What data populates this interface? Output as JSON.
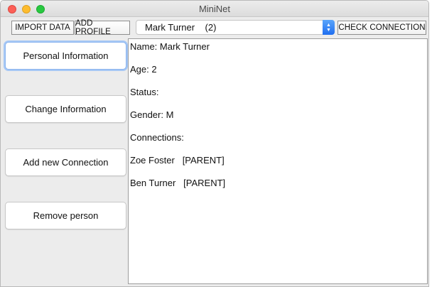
{
  "window": {
    "title": "MiniNet"
  },
  "toolbar": {
    "import_label": "IMPORT DATA",
    "add_profile_label": "ADD PROFILE",
    "person_select_value": "Mark Turner    (2)",
    "check_connection_label": "CHECK CONNECTION"
  },
  "sidebar": {
    "items": [
      {
        "label": "Personal Information"
      },
      {
        "label": "Change Information"
      },
      {
        "label": "Add new Connection"
      },
      {
        "label": "Remove person"
      }
    ]
  },
  "details": {
    "name": "Name: Mark Turner",
    "age": "Age: 2",
    "status": "Status:",
    "gender": "Gender: M",
    "connections_heading": "Connections:",
    "connections": [
      {
        "text": "Zoe Foster   [PARENT]"
      },
      {
        "text": "Ben Turner   [PARENT]"
      }
    ]
  },
  "colors": {
    "close": "#fc5f57",
    "minimize": "#fdbc2e",
    "zoom": "#28c840",
    "select_accent": "#1f6ef0",
    "focus_ring": "#a7c8f5"
  }
}
